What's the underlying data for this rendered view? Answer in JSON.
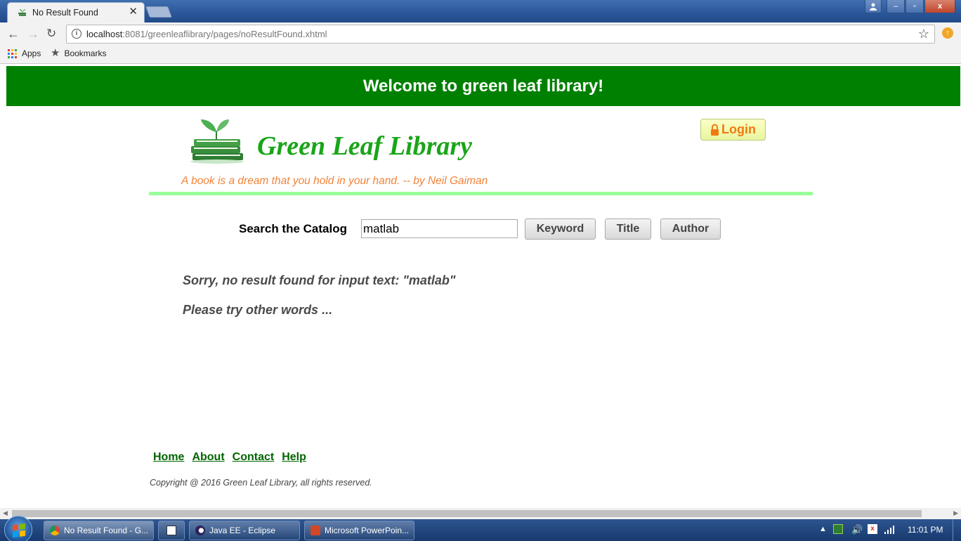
{
  "browser": {
    "tab_title": "No Result Found",
    "tab_close": "✕",
    "window_buttons": {
      "minimize": "–",
      "maximize": "▫",
      "close": "x"
    },
    "url_host": "localhost",
    "url_rest": ":8081/greenleaflibrary/pages/noResultFound.xhtml",
    "bookmarks": {
      "apps": "Apps",
      "bookmarks": "Bookmarks"
    }
  },
  "page": {
    "banner": "Welcome to green leaf library!",
    "logo_text": "Green Leaf Library",
    "login_label": "Login",
    "quote": "A book is a dream that you hold in your hand. -- by Neil Gaiman",
    "search": {
      "label": "Search the Catalog",
      "value": "matlab",
      "buttons": {
        "keyword": "Keyword",
        "title": "Title",
        "author": "Author"
      }
    },
    "messages": {
      "no_result": "Sorry, no result found for input text: \"matlab\"",
      "try_again": "Please try other words ..."
    },
    "footer": {
      "links": [
        "Home",
        "About",
        "Contact",
        "Help"
      ],
      "copyright": "Copyright @ 2016 Green Leaf Library, all rights reserved."
    }
  },
  "taskbar": {
    "items": [
      "No Result Found - G...",
      "Java EE - Eclipse",
      "Microsoft PowerPoin..."
    ],
    "clock": "11:01 PM"
  },
  "colors": {
    "banner_bg": "#008000",
    "logo_text": "#1aa51a",
    "quote": "#f0833a",
    "divider": "#99ff99",
    "link": "#006400",
    "login_text": "#f07a12"
  }
}
